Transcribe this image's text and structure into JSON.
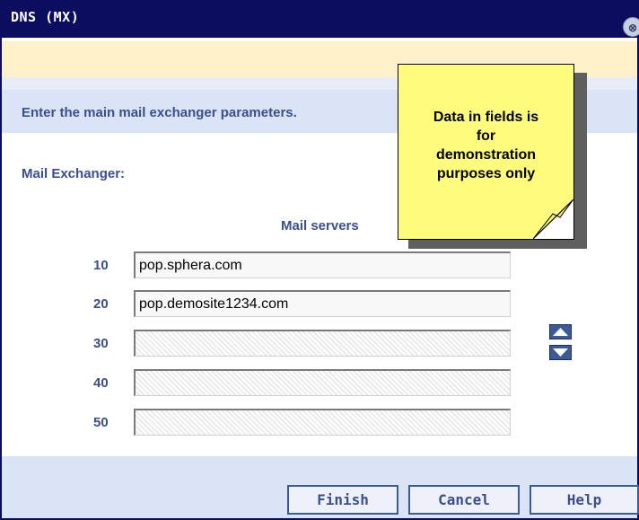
{
  "window": {
    "title": "DNS (MX)",
    "close_glyph": "⊗"
  },
  "instruction": "Enter the main mail exchanger parameters.",
  "section": {
    "label": "Mail Exchanger:",
    "column_header": "Mail servers"
  },
  "rows": [
    {
      "priority": "10",
      "value": "pop.sphera.com"
    },
    {
      "priority": "20",
      "value": "pop.demosite1234.com"
    },
    {
      "priority": "30",
      "value": ""
    },
    {
      "priority": "40",
      "value": ""
    },
    {
      "priority": "50",
      "value": ""
    }
  ],
  "reorder": {
    "up_icon": "triangle-up-icon",
    "down_icon": "triangle-down-icon"
  },
  "note": {
    "line1": "Data in fields is",
    "line2": "for",
    "line3": "demonstration",
    "line4": "purposes only"
  },
  "buttons": {
    "finish": "Finish",
    "cancel": "Cancel",
    "help": "Help"
  },
  "colors": {
    "titlebar": "#0c0d5e",
    "label_text": "#3a4f8e",
    "panel": "#dbe3f6",
    "message_band": "#fff2cb",
    "note": "#fffb7d"
  }
}
